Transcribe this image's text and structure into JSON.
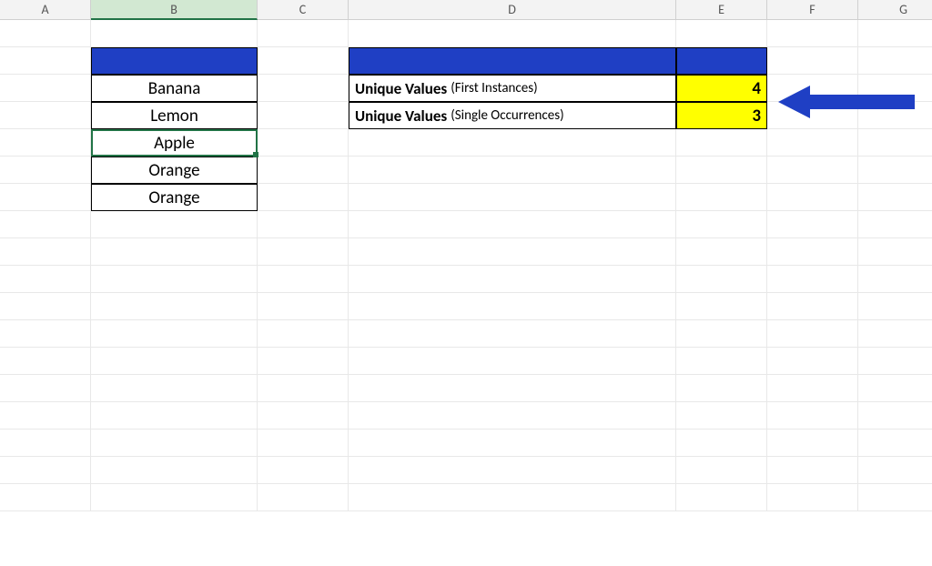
{
  "columns": [
    "A",
    "B",
    "C",
    "D",
    "E",
    "F",
    "G"
  ],
  "selected_column": "B",
  "fruits": {
    "header": "",
    "items": [
      "Banana",
      "Lemon",
      "Apple",
      "Orange",
      "Orange"
    ]
  },
  "unique": {
    "header": "",
    "row1": {
      "label": "Unique Values",
      "sub": "(First Instances)",
      "value": "4"
    },
    "row2": {
      "label": "Unique Values",
      "sub": "(Single Occurrences)",
      "value": "3"
    }
  },
  "colors": {
    "blue": "#1f3fc4",
    "yellow": "#ffff00",
    "arrow": "#1f3fc4"
  }
}
